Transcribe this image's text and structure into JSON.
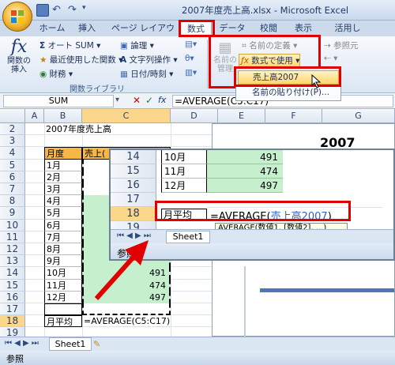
{
  "window": {
    "title": "2007年度売上高.xlsx - Microsoft Excel"
  },
  "tabs": [
    "ホーム",
    "挿入",
    "ページ レイアウト",
    "数式",
    "データ",
    "校閲",
    "表示",
    "活用し"
  ],
  "ribbon": {
    "insert_function": "関数の\n挿入",
    "autosum": "オート SUM",
    "recent": "最近使用した関数",
    "financial": "財務",
    "logical": "論理",
    "text": "文字列操作",
    "datetime": "日付/時刻",
    "group_library": "関数ライブラリ",
    "name_manager": "名前の\n管理",
    "define_name": "名前の定義",
    "use_in_formula": "数式で使用",
    "trace": "参照元"
  },
  "dropdown": {
    "items": [
      "売上高2007",
      "名前の貼り付け(P)..."
    ]
  },
  "formula_bar": {
    "name_box": "SUM",
    "formula": "=AVERAGE(C5:C17)"
  },
  "columns": [
    "A",
    "B",
    "C",
    "D",
    "E",
    "F",
    "G"
  ],
  "rows": [
    "2",
    "3",
    "4",
    "5",
    "6",
    "7",
    "8",
    "9",
    "10",
    "11",
    "12",
    "13",
    "14",
    "15",
    "16",
    "17",
    "18",
    "19"
  ],
  "sheet": {
    "title": "2007年度売上高",
    "header_month": "月度",
    "header_sales": "売上(",
    "months": [
      "1月",
      "2月",
      "3月",
      "4月",
      "5月",
      "6月",
      "7月",
      "8月",
      "9月",
      "10月",
      "11月",
      "12月"
    ],
    "sales_visible": [
      "",
      "",
      "",
      "",
      "",
      "",
      "",
      "",
      "",
      "491",
      "474",
      "497"
    ],
    "avg_label": "月平均",
    "avg_formula": "=AVERAGE(C5:C17)",
    "chart_title_partial": "2007"
  },
  "zoom": {
    "rows": [
      "14",
      "15",
      "16",
      "17",
      "18",
      "19"
    ],
    "months": [
      "10月",
      "11月",
      "12月"
    ],
    "values": [
      "491",
      "474",
      "497"
    ],
    "avg_label": "月平均",
    "formula_prefix": "=AVERAGE(",
    "formula_name": "売上高2007",
    "formula_suffix": ")",
    "tooltip": "AVERAGE(数値1, [数値2], ...)",
    "sheet_tab": "Sheet1",
    "status": "参照"
  },
  "sheet_tab": "Sheet1",
  "status": "参照",
  "colors": {
    "header_fill": "#f5b844",
    "value_fill": "#c6efce",
    "highlight": "#e00000"
  }
}
